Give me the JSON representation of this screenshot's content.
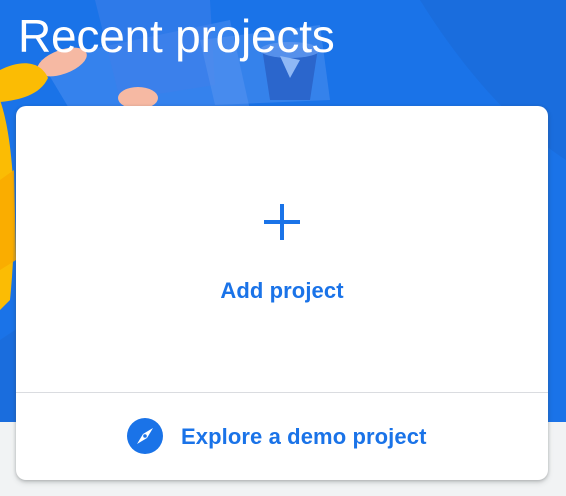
{
  "header": {
    "title": "Recent projects"
  },
  "card": {
    "add_project": {
      "icon": "plus-icon",
      "label": "Add project"
    },
    "explore_demo": {
      "icon": "compass-icon",
      "label": "Explore a demo project"
    }
  },
  "colors": {
    "hero_background": "#1a73e8",
    "accent": "#1a73e8",
    "card_background": "#ffffff",
    "page_background": "#f1f3f4",
    "divider": "#dadce0"
  }
}
